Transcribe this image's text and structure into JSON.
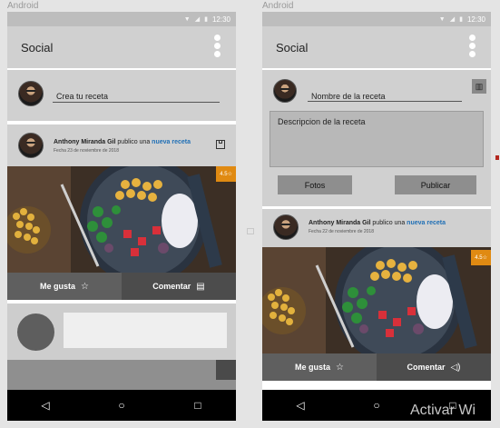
{
  "device_label": "Android",
  "status_time": "12:30",
  "status_icons": [
    "wifi-icon",
    "signal-icon",
    "battery-icon"
  ],
  "appbar": {
    "title": "Social"
  },
  "left": {
    "compose_placeholder": "Crea tu receta",
    "post": {
      "author": "Anthony Miranda Gil",
      "action_text": "publico una",
      "link_text": "nueva receta",
      "date": "Fecha 23 de noviembre de 2018",
      "rating": "4.5",
      "like_label": "Me gusta",
      "comment_label": "Comentar"
    }
  },
  "right": {
    "name_placeholder": "Nombre de la receta",
    "description_placeholder": "Descripcion de la receta",
    "photos_label": "Fotos",
    "publish_label": "Publicar",
    "post": {
      "author": "Anthony Miranda Gil",
      "action_text": "publico una",
      "link_text": "nueva receta",
      "date": "Fecha 22 de noviembre de 2018",
      "rating": "4.5",
      "like_label": "Me gusta",
      "comment_label": "Comentar"
    }
  },
  "nav": [
    "back-icon",
    "home-icon",
    "recents-icon"
  ],
  "watermark": "Activar Wi",
  "colors": {
    "accent": "#e08a12",
    "link": "#1f6fb5",
    "card": "#d0d0d0",
    "nav": "#000000"
  }
}
